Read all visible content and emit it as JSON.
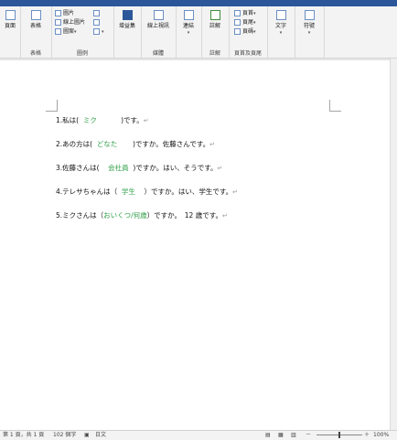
{
  "ribbon": {
    "groups": [
      {
        "label": "",
        "buttons": [
          {
            "label": "頁面"
          }
        ]
      },
      {
        "label": "表格",
        "buttons": [
          {
            "label": "表格"
          }
        ]
      },
      {
        "label": "圖例",
        "items": [
          "圖片",
          "線上圖片",
          "圖案"
        ]
      },
      {
        "label": "",
        "buttons": [
          {
            "label": "增益集"
          }
        ]
      },
      {
        "label": "媒體",
        "buttons": [
          {
            "label": "線上視訊"
          }
        ]
      },
      {
        "label": "",
        "buttons": [
          {
            "label": "連結"
          }
        ]
      },
      {
        "label": "註解",
        "buttons": [
          {
            "label": "註解"
          }
        ]
      },
      {
        "label": "頁首及頁尾",
        "items": [
          "頁首",
          "頁尾",
          "頁碼"
        ]
      },
      {
        "label": "",
        "buttons": [
          {
            "label": "文字"
          }
        ]
      },
      {
        "label": "",
        "buttons": [
          {
            "label": "符號"
          }
        ]
      }
    ]
  },
  "document": {
    "lines": [
      {
        "n": "1.",
        "pre": "私は(",
        "answer": "ミク",
        "post": ")です。"
      },
      {
        "n": "2.",
        "pre": "あの方は(",
        "answer": "どなた",
        "post": ")ですか。佐藤さんです。"
      },
      {
        "n": "3.",
        "pre": "佐藤さんは(",
        "answer": "会社員",
        "post": ")ですか。はい、そうです。"
      },
      {
        "n": "4.",
        "pre": "テレサちゃんは（",
        "answer": "学生",
        "post": "）ですか。はい、学生です。"
      },
      {
        "n": "5.",
        "pre": "ミクさんは（",
        "answer": "おいくつ/何歳",
        "post": "）ですか。　12 歳です。"
      }
    ],
    "paragraph_mark": "↵"
  },
  "status": {
    "page": "第 1 頁，共 1 頁",
    "words": "102 個字",
    "language": "日文",
    "zoom": "100%"
  }
}
